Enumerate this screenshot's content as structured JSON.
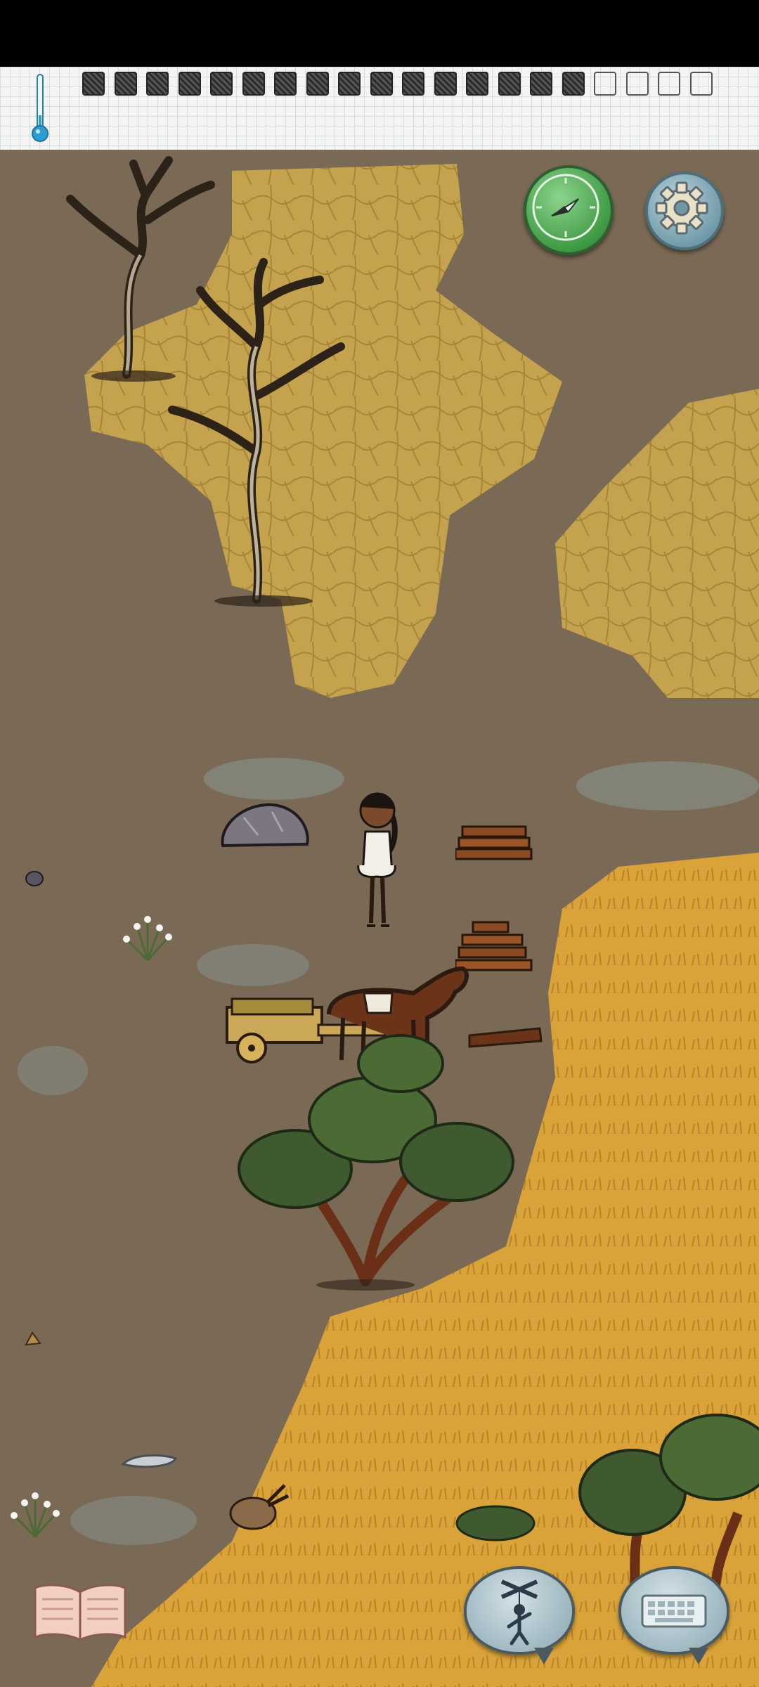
{
  "game": {
    "hud": {
      "thermometer_icon": "thermometer-icon",
      "food_pips_total": 20,
      "food_pips_filled": 16
    },
    "buttons": {
      "compass_icon": "compass-icon",
      "settings_icon": "gear-icon",
      "puppet_icon": "puppet-icon",
      "keyboard_icon": "keyboard-icon",
      "book_icon": "open-book-icon"
    },
    "colors": {
      "dirt": "#7a6a55",
      "dry_earth": "#c9a54e",
      "grass": "#d9a33a",
      "compass": "#4da651",
      "settings": "#7fa3b0"
    }
  }
}
